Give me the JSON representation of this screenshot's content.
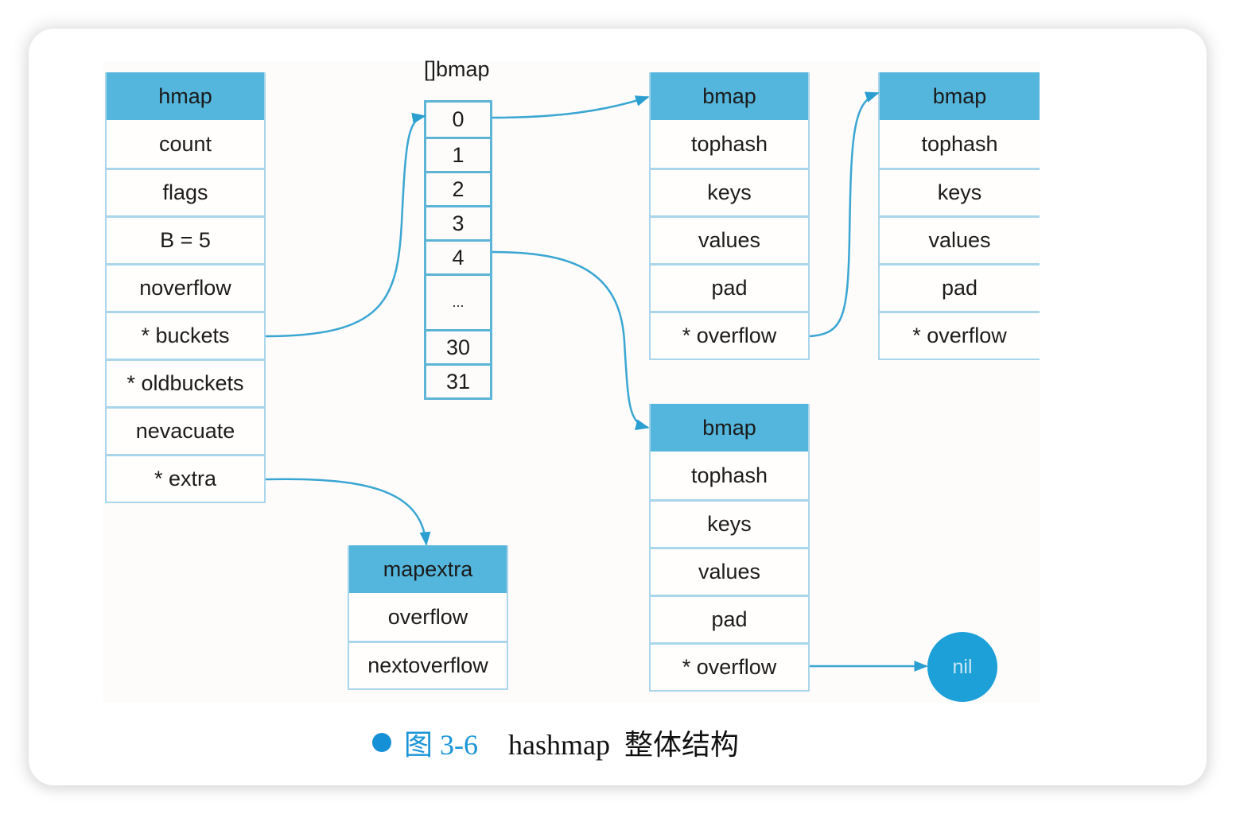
{
  "colors": {
    "header_fill": "#54b6dc",
    "row_border": "#a9d6ea",
    "arrow": "#3aa6d2",
    "nil_fill": "#1da0d8",
    "caption_accent": "#1a95d8"
  },
  "hmap": {
    "title": "hmap",
    "fields": [
      "count",
      "flags",
      "B = 5",
      "noverflow",
      "* buckets",
      "* oldbuckets",
      "nevacuate",
      "* extra"
    ]
  },
  "bucket_array": {
    "title": "[]bmap",
    "cells": [
      "0",
      "1",
      "2",
      "3",
      "4",
      "...",
      "30",
      "31"
    ]
  },
  "bmap_top_left": {
    "title": "bmap",
    "fields": [
      "tophash",
      "keys",
      "values",
      "pad",
      "* overflow"
    ]
  },
  "bmap_top_right": {
    "title": "bmap",
    "fields": [
      "tophash",
      "keys",
      "values",
      "pad",
      "* overflow"
    ]
  },
  "bmap_bottom": {
    "title": "bmap",
    "fields": [
      "tophash",
      "keys",
      "values",
      "pad",
      "* overflow"
    ]
  },
  "mapextra": {
    "title": "mapextra",
    "fields": [
      "overflow",
      "nextoverflow"
    ]
  },
  "nil_node": {
    "label": "nil"
  },
  "links": [
    {
      "from": "hmap.* buckets",
      "to": "[]bmap[0]"
    },
    {
      "from": "[]bmap[0]",
      "to": "bmap (top-left)"
    },
    {
      "from": "[]bmap[4]",
      "to": "bmap (bottom)"
    },
    {
      "from": "bmap (top-left).* overflow",
      "to": "bmap (top-right)"
    },
    {
      "from": "hmap.* extra",
      "to": "mapextra"
    },
    {
      "from": "bmap (bottom).* overflow",
      "to": "nil"
    }
  ],
  "caption": {
    "figure_number": "图 3-6",
    "title": "hashmap  整体结构"
  }
}
